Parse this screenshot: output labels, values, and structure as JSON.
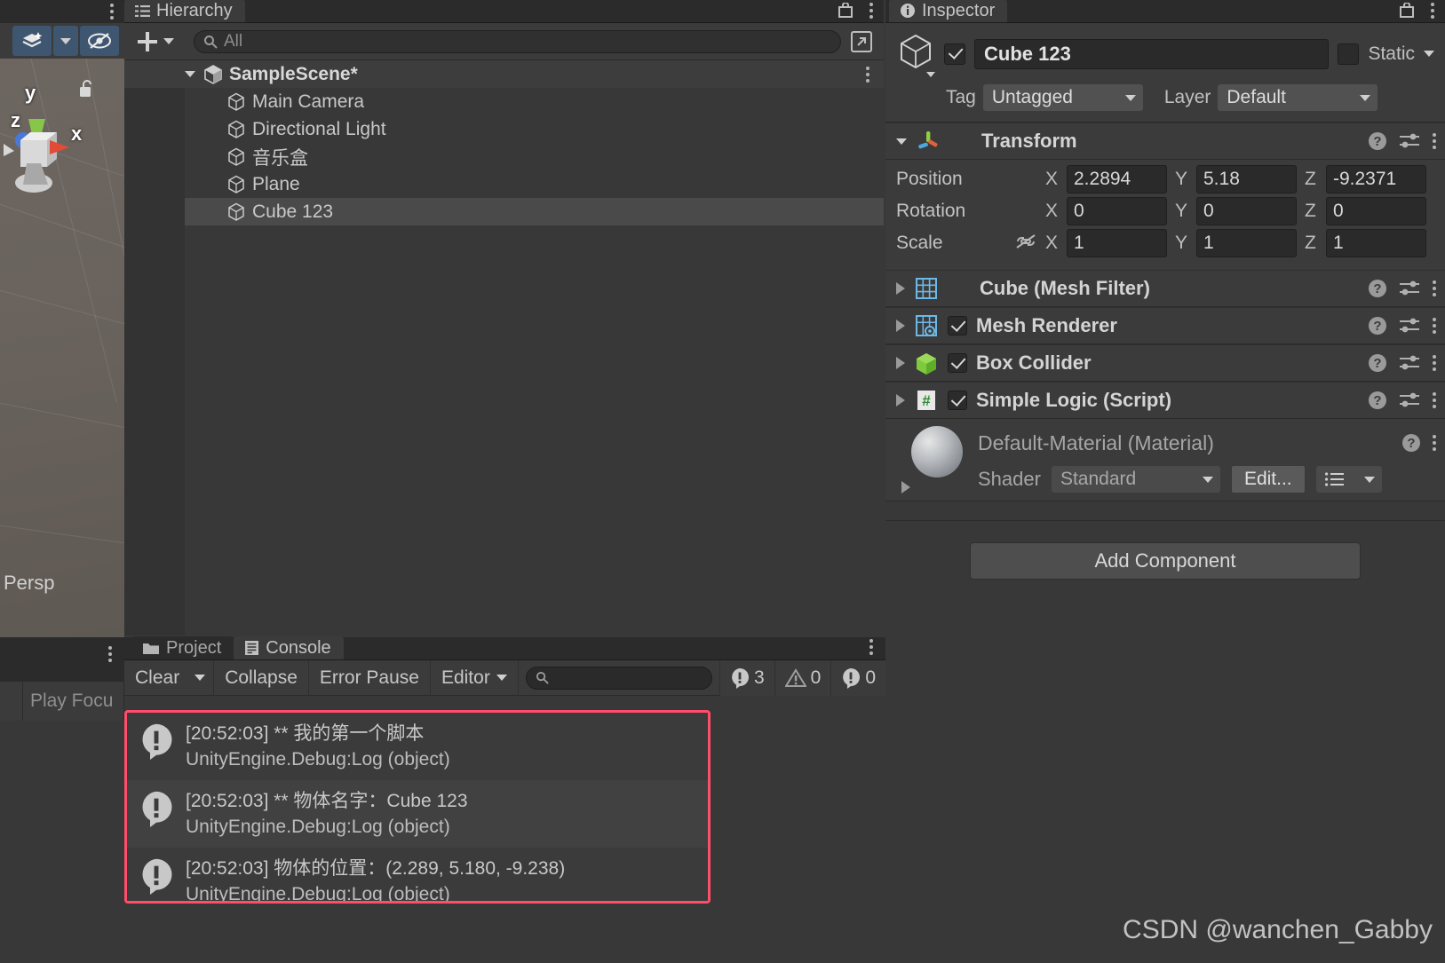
{
  "scene_view": {
    "title_icons": [
      "kebab-icon"
    ],
    "toolbar_buttons": [
      "scene-fx-icon",
      "dropdown-caret",
      "scene-visibility-icon"
    ],
    "gizmo_axes": [
      "y",
      "z",
      "x"
    ],
    "projection_label": "Persp",
    "lock_icon": "unlocked-padlock-icon"
  },
  "hierarchy": {
    "tab_label": "Hierarchy",
    "tab_icon": "hierarchy-icon",
    "add_button": "+",
    "search_placeholder": "All",
    "search_icon": "search-icon",
    "lock_icon": "lock-icon",
    "kebab_icon": "kebab-icon",
    "expand_icon": "expand-window-icon",
    "scene_name": "SampleScene*",
    "items": [
      {
        "label": "Main Camera",
        "selected": false
      },
      {
        "label": "Directional Light",
        "selected": false
      },
      {
        "label": "音乐盒",
        "selected": false
      },
      {
        "label": "Plane",
        "selected": false
      },
      {
        "label": "Cube 123",
        "selected": true
      }
    ]
  },
  "inspector": {
    "tab_label": "Inspector",
    "tab_icon": "info-icon",
    "lock_icon": "lock-icon",
    "kebab_icon": "kebab-icon",
    "object_enabled": true,
    "object_name": "Cube 123",
    "static_label": "Static",
    "static_checked": false,
    "tag_label": "Tag",
    "tag_value": "Untagged",
    "layer_label": "Layer",
    "layer_value": "Default",
    "transform": {
      "title": "Transform",
      "icon": "transform-axis-icon",
      "rows": [
        {
          "label": "Position",
          "x": "2.2894",
          "y": "5.18",
          "z": "-9.2371"
        },
        {
          "label": "Rotation",
          "x": "0",
          "y": "0",
          "z": "0"
        },
        {
          "label": "Scale",
          "x": "1",
          "y": "1",
          "z": "1"
        }
      ],
      "scale_lock_icon": "constrain-proportions-off-icon"
    },
    "components": [
      {
        "title": "Cube (Mesh Filter)",
        "icon": "mesh-filter-icon",
        "has_checkbox": false,
        "checked": false
      },
      {
        "title": "Mesh Renderer",
        "icon": "mesh-renderer-icon",
        "has_checkbox": true,
        "checked": true
      },
      {
        "title": "Box Collider",
        "icon": "box-collider-icon",
        "has_checkbox": true,
        "checked": true
      },
      {
        "title": "Simple Logic (Script)",
        "icon": "csharp-script-icon",
        "has_checkbox": true,
        "checked": true
      }
    ],
    "material": {
      "title": "Default-Material (Material)",
      "preview_icon": "material-sphere-preview",
      "shader_label": "Shader",
      "shader_value": "Standard",
      "edit_button": "Edit...",
      "preset_icon": "preset-list-icon"
    },
    "add_component_label": "Add Component"
  },
  "bottom_left": {
    "kebab_icon": "kebab-icon",
    "play_focus_label": "Play Focu"
  },
  "console": {
    "tabs": [
      {
        "label": "Project",
        "icon": "folder-icon",
        "active": false
      },
      {
        "label": "Console",
        "icon": "console-icon",
        "active": true
      }
    ],
    "kebab_icon": "kebab-icon",
    "toolbar": {
      "clear_label": "Clear",
      "clear_caret": "chevron-down-icon",
      "collapse_label": "Collapse",
      "error_pause_label": "Error Pause",
      "editor_label": "Editor",
      "editor_caret": "chevron-down-icon",
      "search_icon": "search-icon",
      "search_value": "",
      "badges": [
        {
          "icon": "log-info-icon",
          "count": "3"
        },
        {
          "icon": "warning-icon",
          "count": "0"
        },
        {
          "icon": "error-icon",
          "count": "0"
        }
      ]
    },
    "highlight_color": "#ff4d6a",
    "messages": [
      {
        "icon": "log-info-icon",
        "line1": "[20:52:03] ** 我的第一个脚本",
        "line2": "UnityEngine.Debug:Log (object)"
      },
      {
        "icon": "log-info-icon",
        "line1": "[20:52:03] ** 物体名字：Cube 123",
        "line2": "UnityEngine.Debug:Log (object)"
      },
      {
        "icon": "log-info-icon",
        "line1": "[20:52:03] 物体的位置：(2.289, 5.180, -9.238)",
        "line2": "UnityEngine.Debug:Log (object)"
      }
    ]
  },
  "watermark": "CSDN @wanchen_Gabby"
}
